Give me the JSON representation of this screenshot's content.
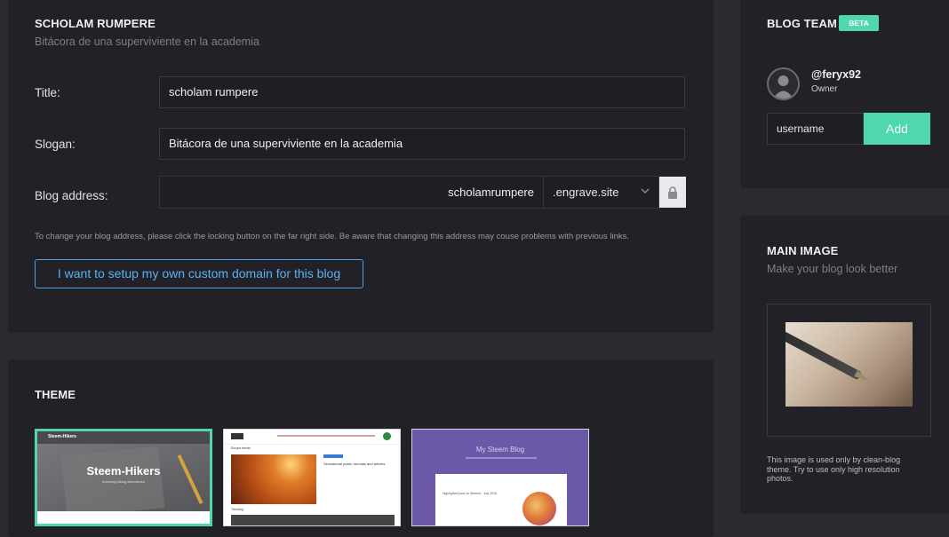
{
  "settings": {
    "title": "SCHOLAM RUMPERE",
    "subtitle": "Bitácora de una superviviente en la academia",
    "title_label": "Title:",
    "title_value": "scholam rumpere",
    "slogan_label": "Slogan:",
    "slogan_value": "Bitácora de una superviviente en la academia",
    "address_label": "Blog address:",
    "address_value": "scholamrumpere",
    "domain_value": ".engrave.site",
    "note": "To change your blog address, please click the locking button on the far right side. Be aware that changing this address may couse problems with previous links.",
    "custom_domain_button": "I want to setup my own custom domain for this blog"
  },
  "theme": {
    "heading": "THEME",
    "themes": [
      {
        "hero_title": "Steem-Hikers",
        "hero_sub": "Amazing hiking adventures",
        "brand": "Steem-Hikers"
      },
      {
        "section_label": "Europe trends",
        "post_title": "Sensational posts, tutorials and articles",
        "section2": "Trending"
      },
      {
        "hero_title": "My Steem Blog",
        "post_title": "Highlighted post on Steemit - July 2018"
      }
    ]
  },
  "team": {
    "heading": "BLOG TEAM",
    "badge": "BETA",
    "member_name": "@feryx92",
    "member_role": "Owner",
    "input_placeholder": "username",
    "add_label": "Add"
  },
  "main_image": {
    "heading": "MAIN IMAGE",
    "subtitle": "Make your blog look better",
    "note": "This image is used only by clean-blog theme. Try to use only high resolution photos."
  },
  "colors": {
    "accent": "#4fd8b0",
    "link": "#5ab2f0",
    "card": "#212127",
    "page": "#2a2a31"
  }
}
